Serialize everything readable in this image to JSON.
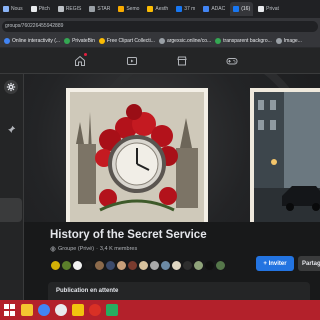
{
  "browser": {
    "tabs": [
      {
        "label": "Nous",
        "color": "#8ab4f8",
        "active": false
      },
      {
        "label": "Pitch",
        "color": "#e8eaed",
        "active": false
      },
      {
        "label": "REGIS",
        "color": "#bdc1c6",
        "active": false
      },
      {
        "label": "STAR",
        "color": "#9aa0a6",
        "active": false
      },
      {
        "label": "Semo",
        "color": "#f9ab00",
        "active": false
      },
      {
        "label": "Aesth",
        "color": "#fbbc04",
        "active": false
      },
      {
        "label": "37 m",
        "color": "#1877f2",
        "active": false
      },
      {
        "label": "ADAC",
        "color": "#4285f4",
        "active": false
      },
      {
        "label": "(16)",
        "color": "#1877f2",
        "active": true
      },
      {
        "label": "Privat",
        "color": "#e8eaed",
        "active": false
      }
    ],
    "url": "groups/760226455942889",
    "bookmarks": [
      {
        "label": "Online interactivity (...",
        "color": "#4285f4"
      },
      {
        "label": "PrivateBin",
        "color": "#34a853"
      },
      {
        "label": "Free Clipart Collecti...",
        "color": "#fbbc04"
      },
      {
        "label": "argexsic.online/co...",
        "color": "#9aa0a6"
      },
      {
        "label": "transparent backgro...",
        "color": "#34a853"
      },
      {
        "label": "Image...",
        "color": "#9aa0a6"
      }
    ]
  },
  "nav": {
    "icons": [
      "home-icon",
      "video-icon",
      "marketplace-icon",
      "gaming-icon"
    ]
  },
  "group": {
    "name": "History of the Secret Service",
    "privacy": "Groupe (Privé)",
    "separator": "·",
    "member_count": "3,4 K membres",
    "invite_label": "+ Inviter",
    "share_label": "Partager",
    "pending_label": "Publication en attente"
  },
  "member_colors": [
    "#d4b106",
    "#5b7f2b",
    "#f2f2f2",
    "#1c1c1c",
    "#8c6a4b",
    "#3b4a6b",
    "#c9a07a",
    "#7a3b2e",
    "#d8c29d",
    "#a9a9a9",
    "#6c8aa5",
    "#e0d6c2",
    "#2e2e2e",
    "#8fa37a",
    "#111111",
    "#55774a"
  ],
  "colors": {
    "accent": "#2374e1",
    "taskbar": "#b3212b",
    "surface": "#242526",
    "background": "#18191a"
  }
}
